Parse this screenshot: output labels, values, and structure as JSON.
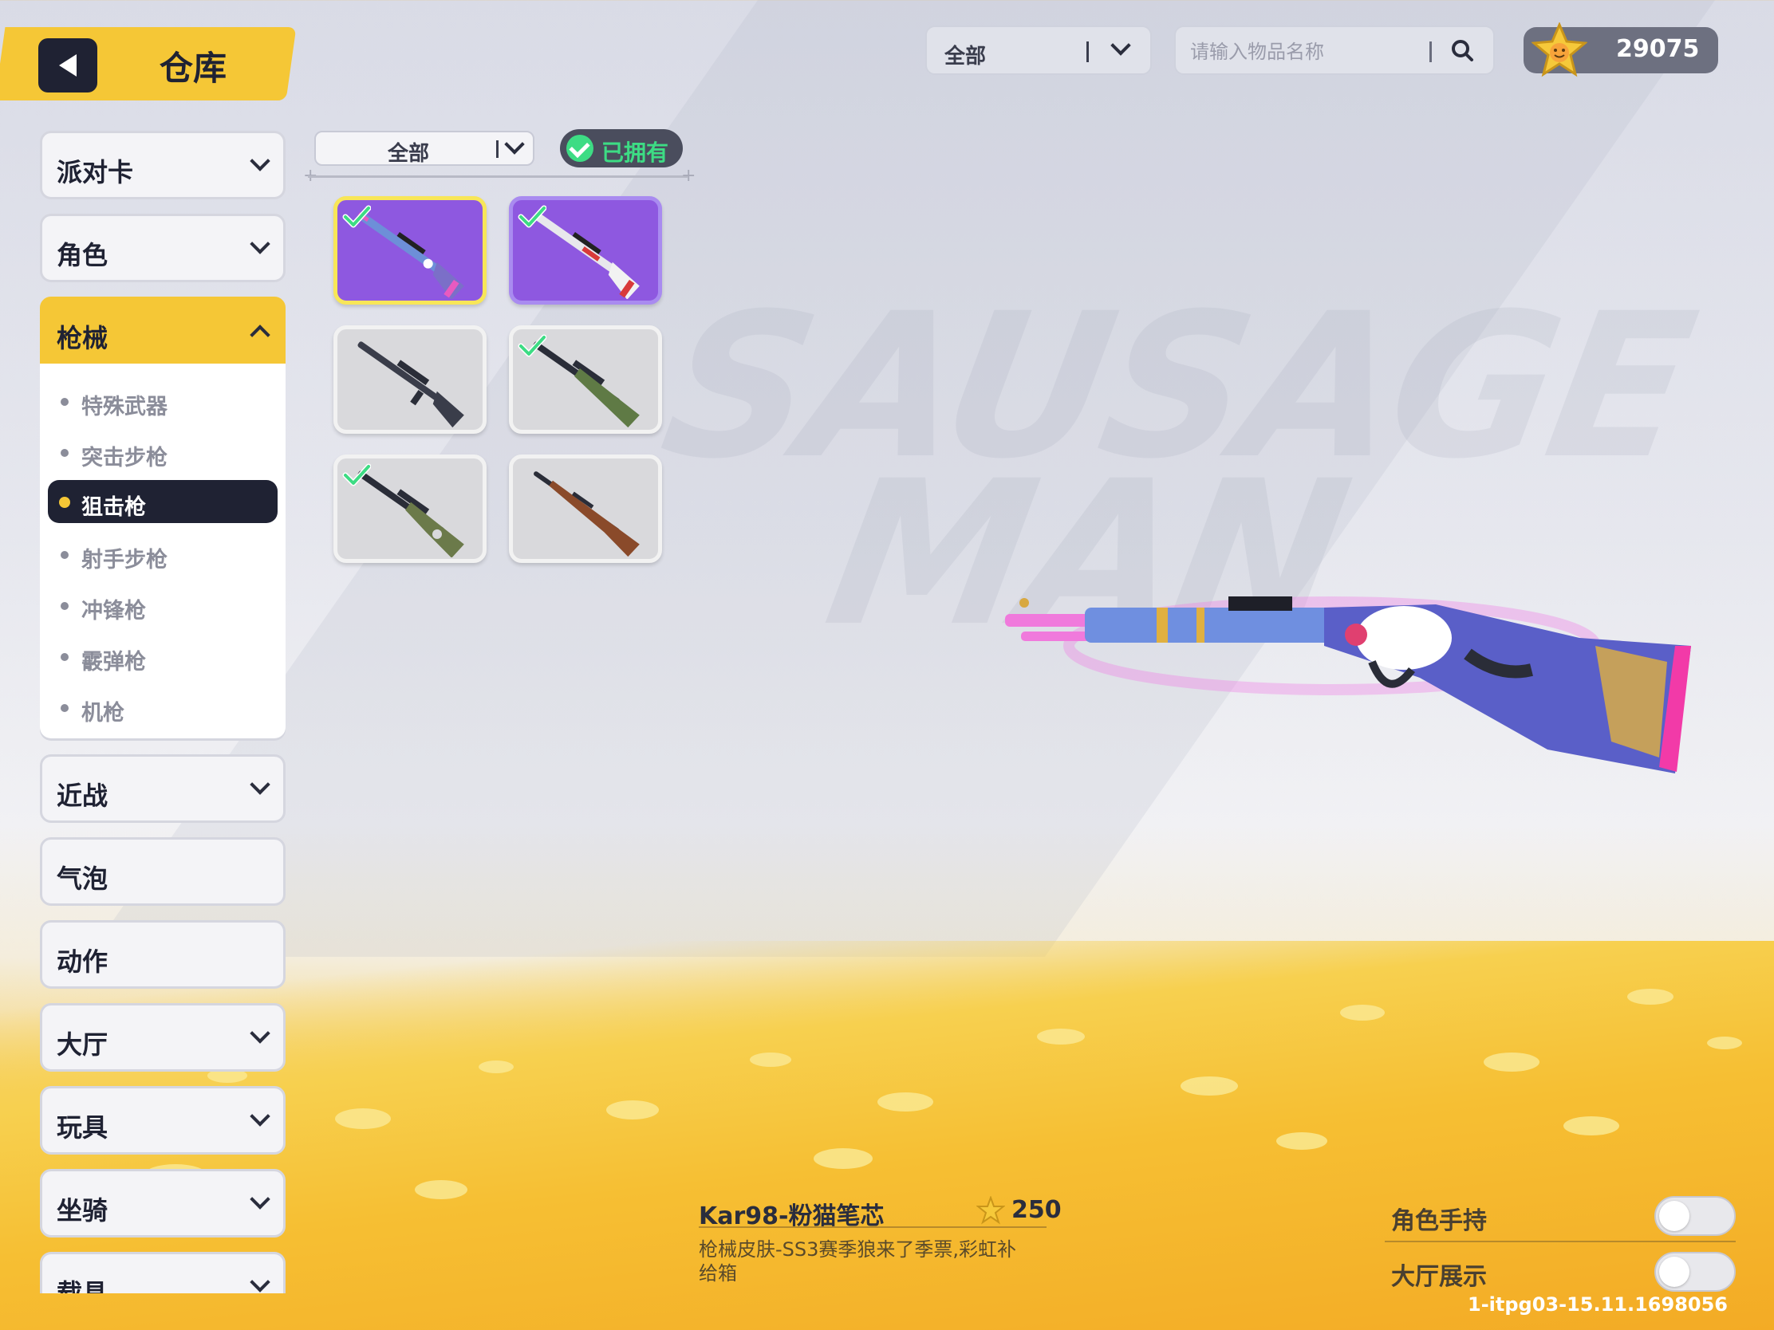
{
  "header": {
    "title": "仓库",
    "category_select": "全部",
    "search_placeholder": "请输入物品名称",
    "coins": "29075"
  },
  "sidebar": {
    "items": [
      {
        "label": "派对卡",
        "expandable": true
      },
      {
        "label": "角色",
        "expandable": true
      },
      {
        "label": "枪械",
        "expandable": true,
        "expanded": true
      },
      {
        "label": "近战",
        "expandable": true
      },
      {
        "label": "气泡",
        "expandable": false
      },
      {
        "label": "动作",
        "expandable": false
      },
      {
        "label": "大厅",
        "expandable": true
      },
      {
        "label": "玩具",
        "expandable": true
      },
      {
        "label": "坐骑",
        "expandable": true
      },
      {
        "label": "载具",
        "expandable": true
      }
    ],
    "sub_items": [
      "特殊武器",
      "突击步枪",
      "狙击枪",
      "射手步枪",
      "冲锋枪",
      "霰弹枪",
      "机枪"
    ],
    "selected_sub": "狙击枪"
  },
  "filter": {
    "select": "全部",
    "owned_label": "已拥有"
  },
  "grid": {
    "items": [
      {
        "name": "kar98-pink-cat",
        "style": "purple",
        "owned": true,
        "selected": true
      },
      {
        "name": "kar98-skin-white-red",
        "style": "purple",
        "owned": true,
        "selected": false
      },
      {
        "name": "sniper-dark",
        "style": "gray",
        "owned": false,
        "selected": false
      },
      {
        "name": "sniper-green",
        "style": "gray",
        "owned": true,
        "selected": false
      },
      {
        "name": "awm-green",
        "style": "gray",
        "owned": true,
        "selected": false
      },
      {
        "name": "kar98-wood",
        "style": "gray",
        "owned": false,
        "selected": false
      }
    ]
  },
  "detail": {
    "name": "Kar98-粉猫笔芯",
    "price": "250",
    "description": "枪械皮肤-SS3赛季狼来了季票,彩虹补给箱"
  },
  "options": {
    "hold_label": "角色手持",
    "lobby_label": "大厅展示"
  },
  "version": "1-itpg03-15.11.1698056",
  "colors": {
    "accent": "#f5c736",
    "dark": "#1f2233",
    "owned_green": "#3ddc84",
    "rare_purple": "#8e58e0"
  }
}
